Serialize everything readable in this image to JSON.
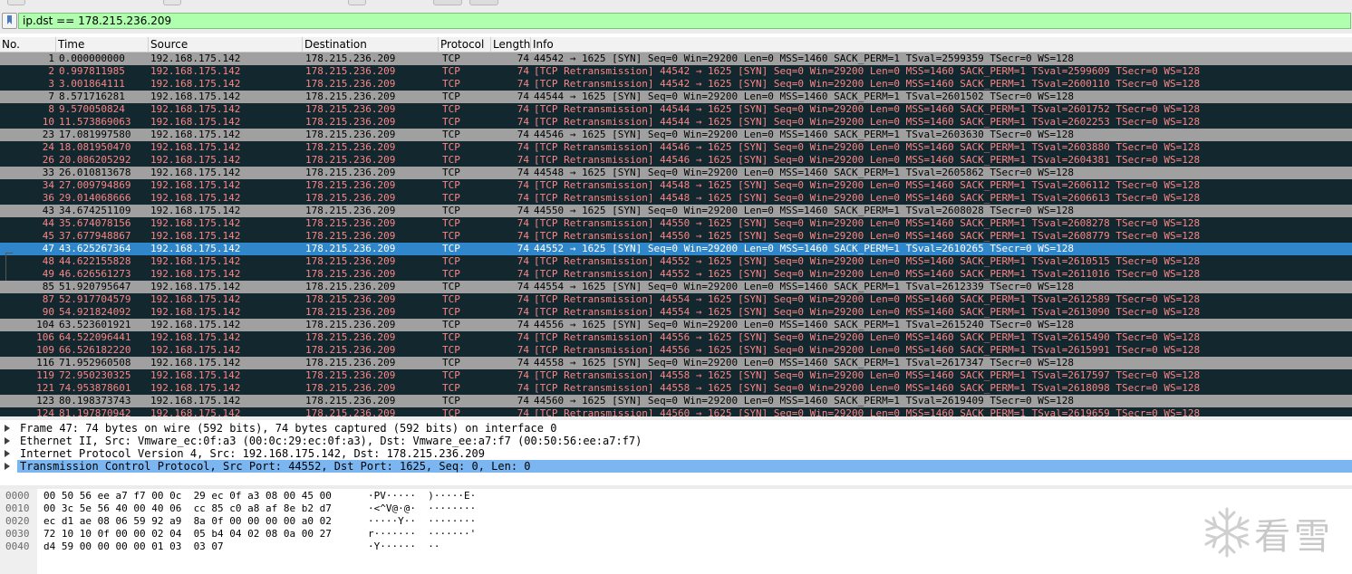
{
  "filter": {
    "value": "ip.dst == 178.215.236.209"
  },
  "columns": {
    "no": "No.",
    "time": "Time",
    "source": "Source",
    "destination": "Destination",
    "protocol": "Protocol",
    "length": "Length",
    "info": "Info"
  },
  "colors": {
    "syn_row_bg": "#a0a0a0",
    "retransmission_row_bg": "#12272e",
    "retransmission_row_fg": "#f78787",
    "selected_row_bg": "#2f86ca",
    "filter_ok_bg": "#afffaf"
  },
  "packets": [
    {
      "no": "1",
      "time": "0.000000000",
      "src": "192.168.175.142",
      "dst": "178.215.236.209",
      "proto": "TCP",
      "len": "74",
      "info": "44542 → 1625 [SYN] Seq=0 Win=29200 Len=0 MSS=1460 SACK_PERM=1 TSval=2599359 TSecr=0 WS=128",
      "kind": "syn"
    },
    {
      "no": "2",
      "time": "0.997811985",
      "src": "192.168.175.142",
      "dst": "178.215.236.209",
      "proto": "TCP",
      "len": "74",
      "info": "[TCP Retransmission] 44542 → 1625 [SYN] Seq=0 Win=29200 Len=0 MSS=1460 SACK_PERM=1 TSval=2599609 TSecr=0 WS=128",
      "kind": "retx"
    },
    {
      "no": "3",
      "time": "3.001864111",
      "src": "192.168.175.142",
      "dst": "178.215.236.209",
      "proto": "TCP",
      "len": "74",
      "info": "[TCP Retransmission] 44542 → 1625 [SYN] Seq=0 Win=29200 Len=0 MSS=1460 SACK_PERM=1 TSval=2600110 TSecr=0 WS=128",
      "kind": "retx"
    },
    {
      "no": "7",
      "time": "8.571716281",
      "src": "192.168.175.142",
      "dst": "178.215.236.209",
      "proto": "TCP",
      "len": "74",
      "info": "44544 → 1625 [SYN] Seq=0 Win=29200 Len=0 MSS=1460 SACK_PERM=1 TSval=2601502 TSecr=0 WS=128",
      "kind": "syn"
    },
    {
      "no": "8",
      "time": "9.570050824",
      "src": "192.168.175.142",
      "dst": "178.215.236.209",
      "proto": "TCP",
      "len": "74",
      "info": "[TCP Retransmission] 44544 → 1625 [SYN] Seq=0 Win=29200 Len=0 MSS=1460 SACK_PERM=1 TSval=2601752 TSecr=0 WS=128",
      "kind": "retx"
    },
    {
      "no": "10",
      "time": "11.573869063",
      "src": "192.168.175.142",
      "dst": "178.215.236.209",
      "proto": "TCP",
      "len": "74",
      "info": "[TCP Retransmission] 44544 → 1625 [SYN] Seq=0 Win=29200 Len=0 MSS=1460 SACK_PERM=1 TSval=2602253 TSecr=0 WS=128",
      "kind": "retx"
    },
    {
      "no": "23",
      "time": "17.081997580",
      "src": "192.168.175.142",
      "dst": "178.215.236.209",
      "proto": "TCP",
      "len": "74",
      "info": "44546 → 1625 [SYN] Seq=0 Win=29200 Len=0 MSS=1460 SACK_PERM=1 TSval=2603630 TSecr=0 WS=128",
      "kind": "syn"
    },
    {
      "no": "24",
      "time": "18.081950470",
      "src": "192.168.175.142",
      "dst": "178.215.236.209",
      "proto": "TCP",
      "len": "74",
      "info": "[TCP Retransmission] 44546 → 1625 [SYN] Seq=0 Win=29200 Len=0 MSS=1460 SACK_PERM=1 TSval=2603880 TSecr=0 WS=128",
      "kind": "retx"
    },
    {
      "no": "26",
      "time": "20.086205292",
      "src": "192.168.175.142",
      "dst": "178.215.236.209",
      "proto": "TCP",
      "len": "74",
      "info": "[TCP Retransmission] 44546 → 1625 [SYN] Seq=0 Win=29200 Len=0 MSS=1460 SACK_PERM=1 TSval=2604381 TSecr=0 WS=128",
      "kind": "retx"
    },
    {
      "no": "33",
      "time": "26.010813678",
      "src": "192.168.175.142",
      "dst": "178.215.236.209",
      "proto": "TCP",
      "len": "74",
      "info": "44548 → 1625 [SYN] Seq=0 Win=29200 Len=0 MSS=1460 SACK_PERM=1 TSval=2605862 TSecr=0 WS=128",
      "kind": "syn"
    },
    {
      "no": "34",
      "time": "27.009794869",
      "src": "192.168.175.142",
      "dst": "178.215.236.209",
      "proto": "TCP",
      "len": "74",
      "info": "[TCP Retransmission] 44548 → 1625 [SYN] Seq=0 Win=29200 Len=0 MSS=1460 SACK_PERM=1 TSval=2606112 TSecr=0 WS=128",
      "kind": "retx"
    },
    {
      "no": "36",
      "time": "29.014068666",
      "src": "192.168.175.142",
      "dst": "178.215.236.209",
      "proto": "TCP",
      "len": "74",
      "info": "[TCP Retransmission] 44548 → 1625 [SYN] Seq=0 Win=29200 Len=0 MSS=1460 SACK_PERM=1 TSval=2606613 TSecr=0 WS=128",
      "kind": "retx"
    },
    {
      "no": "43",
      "time": "34.674251109",
      "src": "192.168.175.142",
      "dst": "178.215.236.209",
      "proto": "TCP",
      "len": "74",
      "info": "44550 → 1625 [SYN] Seq=0 Win=29200 Len=0 MSS=1460 SACK_PERM=1 TSval=2608028 TSecr=0 WS=128",
      "kind": "syn"
    },
    {
      "no": "44",
      "time": "35.674078156",
      "src": "192.168.175.142",
      "dst": "178.215.236.209",
      "proto": "TCP",
      "len": "74",
      "info": "[TCP Retransmission] 44550 → 1625 [SYN] Seq=0 Win=29200 Len=0 MSS=1460 SACK_PERM=1 TSval=2608278 TSecr=0 WS=128",
      "kind": "retx"
    },
    {
      "no": "45",
      "time": "37.677948867",
      "src": "192.168.175.142",
      "dst": "178.215.236.209",
      "proto": "TCP",
      "len": "74",
      "info": "[TCP Retransmission] 44550 → 1625 [SYN] Seq=0 Win=29200 Len=0 MSS=1460 SACK_PERM=1 TSval=2608779 TSecr=0 WS=128",
      "kind": "retx"
    },
    {
      "no": "47",
      "time": "43.625267364",
      "src": "192.168.175.142",
      "dst": "178.215.236.209",
      "proto": "TCP",
      "len": "74",
      "info": "44552 → 1625 [SYN] Seq=0 Win=29200 Len=0 MSS=1460 SACK_PERM=1 TSval=2610265 TSecr=0 WS=128",
      "kind": "selected"
    },
    {
      "no": "48",
      "time": "44.622155828",
      "src": "192.168.175.142",
      "dst": "178.215.236.209",
      "proto": "TCP",
      "len": "74",
      "info": "[TCP Retransmission] 44552 → 1625 [SYN] Seq=0 Win=29200 Len=0 MSS=1460 SACK_PERM=1 TSval=2610515 TSecr=0 WS=128",
      "kind": "retx"
    },
    {
      "no": "49",
      "time": "46.626561273",
      "src": "192.168.175.142",
      "dst": "178.215.236.209",
      "proto": "TCP",
      "len": "74",
      "info": "[TCP Retransmission] 44552 → 1625 [SYN] Seq=0 Win=29200 Len=0 MSS=1460 SACK_PERM=1 TSval=2611016 TSecr=0 WS=128",
      "kind": "retx"
    },
    {
      "no": "85",
      "time": "51.920795647",
      "src": "192.168.175.142",
      "dst": "178.215.236.209",
      "proto": "TCP",
      "len": "74",
      "info": "44554 → 1625 [SYN] Seq=0 Win=29200 Len=0 MSS=1460 SACK_PERM=1 TSval=2612339 TSecr=0 WS=128",
      "kind": "syn"
    },
    {
      "no": "87",
      "time": "52.917704579",
      "src": "192.168.175.142",
      "dst": "178.215.236.209",
      "proto": "TCP",
      "len": "74",
      "info": "[TCP Retransmission] 44554 → 1625 [SYN] Seq=0 Win=29200 Len=0 MSS=1460 SACK_PERM=1 TSval=2612589 TSecr=0 WS=128",
      "kind": "retx"
    },
    {
      "no": "90",
      "time": "54.921824092",
      "src": "192.168.175.142",
      "dst": "178.215.236.209",
      "proto": "TCP",
      "len": "74",
      "info": "[TCP Retransmission] 44554 → 1625 [SYN] Seq=0 Win=29200 Len=0 MSS=1460 SACK_PERM=1 TSval=2613090 TSecr=0 WS=128",
      "kind": "retx"
    },
    {
      "no": "104",
      "time": "63.523601921",
      "src": "192.168.175.142",
      "dst": "178.215.236.209",
      "proto": "TCP",
      "len": "74",
      "info": "44556 → 1625 [SYN] Seq=0 Win=29200 Len=0 MSS=1460 SACK_PERM=1 TSval=2615240 TSecr=0 WS=128",
      "kind": "syn"
    },
    {
      "no": "106",
      "time": "64.522096441",
      "src": "192.168.175.142",
      "dst": "178.215.236.209",
      "proto": "TCP",
      "len": "74",
      "info": "[TCP Retransmission] 44556 → 1625 [SYN] Seq=0 Win=29200 Len=0 MSS=1460 SACK_PERM=1 TSval=2615490 TSecr=0 WS=128",
      "kind": "retx"
    },
    {
      "no": "109",
      "time": "66.526182220",
      "src": "192.168.175.142",
      "dst": "178.215.236.209",
      "proto": "TCP",
      "len": "74",
      "info": "[TCP Retransmission] 44556 → 1625 [SYN] Seq=0 Win=29200 Len=0 MSS=1460 SACK_PERM=1 TSval=2615991 TSecr=0 WS=128",
      "kind": "retx"
    },
    {
      "no": "116",
      "time": "71.952960508",
      "src": "192.168.175.142",
      "dst": "178.215.236.209",
      "proto": "TCP",
      "len": "74",
      "info": "44558 → 1625 [SYN] Seq=0 Win=29200 Len=0 MSS=1460 SACK_PERM=1 TSval=2617347 TSecr=0 WS=128",
      "kind": "syn"
    },
    {
      "no": "119",
      "time": "72.950230325",
      "src": "192.168.175.142",
      "dst": "178.215.236.209",
      "proto": "TCP",
      "len": "74",
      "info": "[TCP Retransmission] 44558 → 1625 [SYN] Seq=0 Win=29200 Len=0 MSS=1460 SACK_PERM=1 TSval=2617597 TSecr=0 WS=128",
      "kind": "retx"
    },
    {
      "no": "121",
      "time": "74.953878601",
      "src": "192.168.175.142",
      "dst": "178.215.236.209",
      "proto": "TCP",
      "len": "74",
      "info": "[TCP Retransmission] 44558 → 1625 [SYN] Seq=0 Win=29200 Len=0 MSS=1460 SACK_PERM=1 TSval=2618098 TSecr=0 WS=128",
      "kind": "retx"
    },
    {
      "no": "123",
      "time": "80.198373743",
      "src": "192.168.175.142",
      "dst": "178.215.236.209",
      "proto": "TCP",
      "len": "74",
      "info": "44560 → 1625 [SYN] Seq=0 Win=29200 Len=0 MSS=1460 SACK_PERM=1 TSval=2619409 TSecr=0 WS=128",
      "kind": "syn"
    },
    {
      "no": "124",
      "time": "81.197870942",
      "src": "192.168.175.142",
      "dst": "178.215.236.209",
      "proto": "TCP",
      "len": "74",
      "info": "[TCP Retransmission] 44560 → 1625 [SYN] Seq=0 Win=29200 Len=0 MSS=1460 SACK_PERM=1 TSval=2619659 TSecr=0 WS=128",
      "kind": "retx"
    }
  ],
  "details": [
    {
      "text": "Frame 47: 74 bytes on wire (592 bits), 74 bytes captured (592 bits) on interface 0",
      "selected": false
    },
    {
      "text": "Ethernet II, Src: Vmware_ec:0f:a3 (00:0c:29:ec:0f:a3), Dst: Vmware_ee:a7:f7 (00:50:56:ee:a7:f7)",
      "selected": false
    },
    {
      "text": "Internet Protocol Version 4, Src: 192.168.175.142, Dst: 178.215.236.209",
      "selected": false
    },
    {
      "text": "Transmission Control Protocol, Src Port: 44552, Dst Port: 1625, Seq: 0, Len: 0",
      "selected": true
    }
  ],
  "hex": [
    {
      "offset": "0000",
      "hex": "00 50 56 ee a7 f7 00 0c  29 ec 0f a3 08 00 45 00",
      "ascii": "·PV·····  )·····E·"
    },
    {
      "offset": "0010",
      "hex": "00 3c 5e 56 40 00 40 06  cc 85 c0 a8 af 8e b2 d7",
      "ascii": "·<^V@·@·  ········"
    },
    {
      "offset": "0020",
      "hex": "ec d1 ae 08 06 59 92 a9  8a 0f 00 00 00 00 a0 02",
      "ascii": "·····Y··  ········"
    },
    {
      "offset": "0030",
      "hex": "72 10 10 0f 00 00 02 04  05 b4 04 02 08 0a 00 27",
      "ascii": "r·······  ·······'"
    },
    {
      "offset": "0040",
      "hex": "d4 59 00 00 00 00 01 03  03 07",
      "ascii": "·Y······  ··"
    }
  ],
  "watermark": {
    "text": "看雪",
    "icon": "snowflake-icon"
  }
}
